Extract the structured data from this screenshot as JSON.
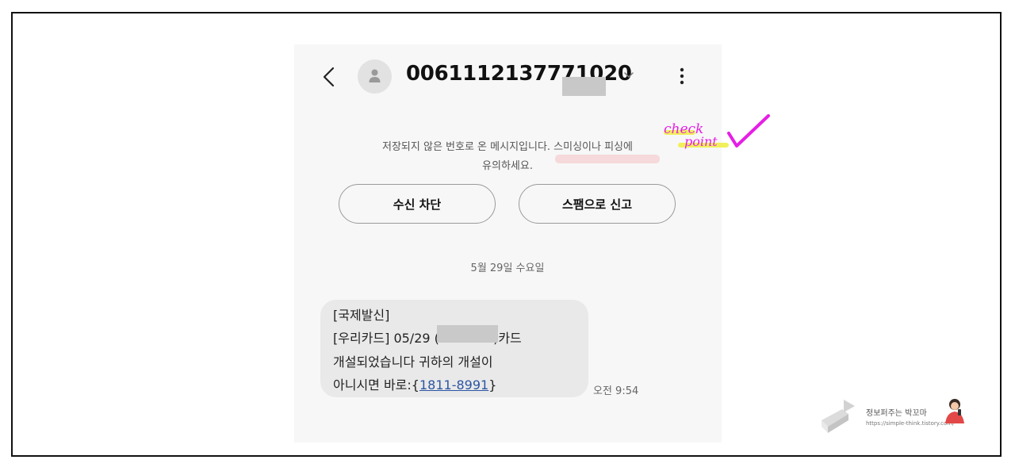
{
  "header": {
    "title": "0061112137771020",
    "back_icon": "chevron-left-icon",
    "dropdown_icon": "chevron-down-icon",
    "menu_icon": "kebab-menu-icon",
    "avatar_icon": "person-icon"
  },
  "warning": {
    "line1": "저장되지 않은 번호로 온 메시지입니다. 스미싱이나 피싱에",
    "line2": "유의하세요."
  },
  "annotation": {
    "line1": "check",
    "line2": "point",
    "accent": "#e61ee6",
    "marker": "#f1f05a"
  },
  "actions": {
    "block_label": "수신 차단",
    "spam_label": "스팸으로 신고"
  },
  "date_divider": "5월 29일 수요일",
  "message": {
    "line1": "[국제발신]",
    "line2a": "[우리카드] 05/29 (",
    "line2b": "7)카드",
    "line3": "개설되었습니다 귀하의 개설이",
    "line4_prefix": "아니시면 바로:{",
    "line4_link": "1811-8991",
    "line4_suffix": "}",
    "time": "오전 9:54"
  },
  "watermark": {
    "title": "정보퍼주는 박꼬마",
    "url": "https://simple-think.tistory.com/"
  }
}
